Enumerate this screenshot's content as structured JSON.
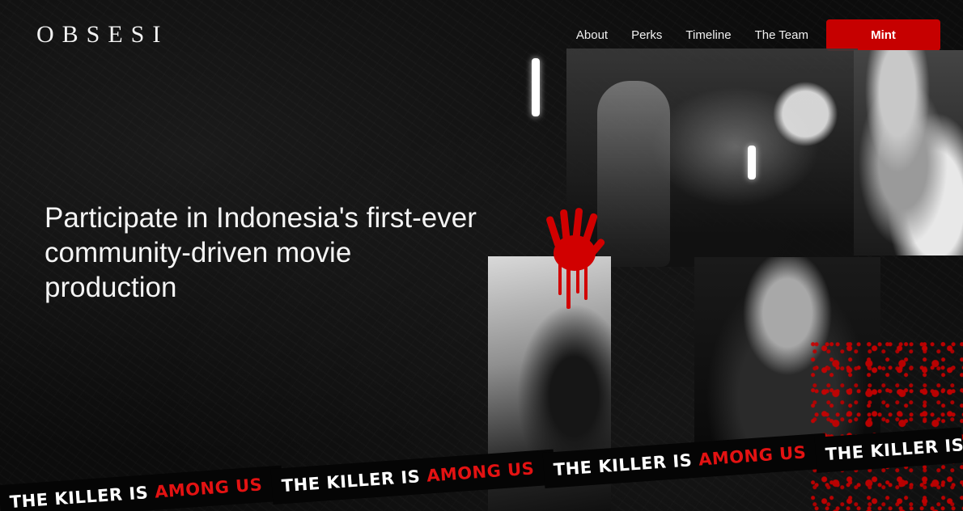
{
  "brand": {
    "logo": "OBSESI"
  },
  "nav": {
    "links": [
      "About",
      "Perks",
      "Timeline",
      "The Team"
    ],
    "cta": "Mint"
  },
  "hero": {
    "line_before": "Participate in Indonesia's first-ever",
    "highlight": "community-driven",
    "line_after": "movie production"
  },
  "banners": [
    {
      "white": "THE KILLER IS",
      "red": "AMONG US"
    },
    {
      "white": "THE KILLER IS",
      "red": "AMONG US"
    },
    {
      "white": "THE KILLER IS",
      "red": "AMONG US"
    },
    {
      "white": "THE KILLER IS",
      "red": ""
    }
  ],
  "colors": {
    "accent": "#c60000",
    "background": "#0b0b0b"
  }
}
